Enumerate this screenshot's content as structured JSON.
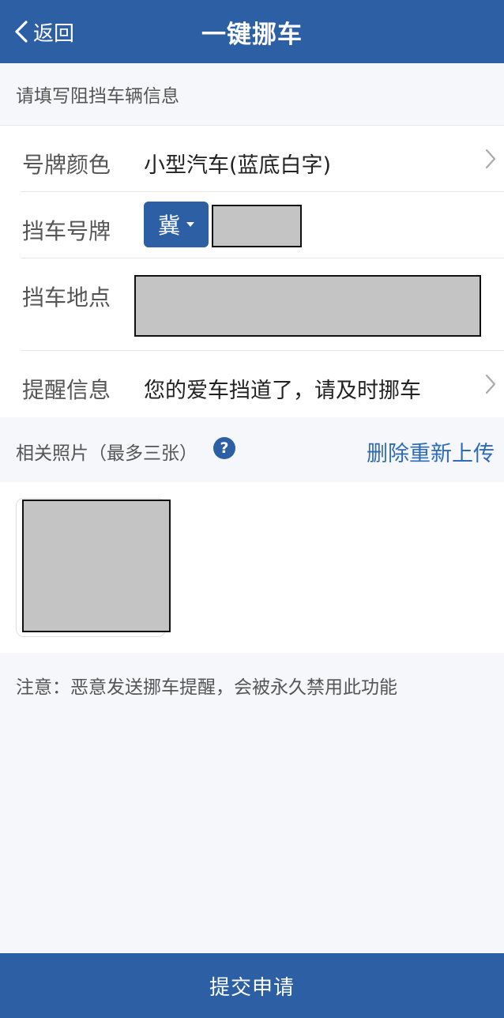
{
  "header": {
    "back_label": "返回",
    "title": "一键挪车"
  },
  "section_title": "请填写阻挡车辆信息",
  "form": {
    "plate_color": {
      "label": "号牌颜色",
      "value": "小型汽车(蓝底白字)"
    },
    "plate_number": {
      "label": "挡车号牌",
      "province": "冀",
      "number": ""
    },
    "location": {
      "label": "挡车地点",
      "value": ""
    },
    "reminder": {
      "label": "提醒信息",
      "value": "您的爱车挡道了，请及时挪车"
    }
  },
  "photos": {
    "title": "相关照片（最多三张）",
    "help_icon_text": "?",
    "reupload_label": "删除重新上传"
  },
  "notice": "注意：恶意发送挪车提醒，会被永久禁用此功能",
  "submit_label": "提交申请",
  "colors": {
    "primary": "#2d5fa5",
    "link": "#2d6bb7",
    "background": "#f5f7fb",
    "redacted": "#c4c4c4"
  }
}
